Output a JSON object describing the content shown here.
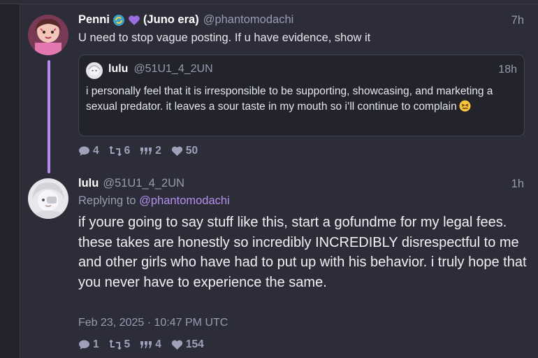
{
  "post": {
    "name": "Penni",
    "name_suffix": "(Juno era)",
    "handle": "@phantomodachi",
    "time": "7h",
    "text": "U need to stop vague posting. If u have evidence, show it",
    "quote": {
      "name": "lulu",
      "handle": "@51U1_4_2UN",
      "time": "18h",
      "text": "i personally feel that it is irresponsible to be supporting, showcasing, and marketing a sexual predator. it leaves a sour taste in my mouth so i’ll continue to complain"
    },
    "stats": {
      "replies": "4",
      "reposts": "6",
      "quotes": "2",
      "likes": "50"
    }
  },
  "reply": {
    "name": "lulu",
    "handle": "@51U1_4_2UN",
    "time": "1h",
    "replying_label": "Replying to",
    "replying_to": "@phantomodachi",
    "line1": "if youre going to say stuff like this, start a gofundme for my legal fees.",
    "line2": "these takes are honestly so incredibly INCREDIBLY disrespectful to me and other girls who have had to put up with his behavior. i truly hope that you never have to experience the same.",
    "date": "Feb 23, 2025 · 10:47 PM UTC",
    "stats": {
      "replies": "1",
      "reposts": "5",
      "quotes": "4",
      "likes": "154"
    }
  },
  "colors": {
    "accent": "#b08ee8",
    "mention": "#b48ef0",
    "stat": "#9fa1bb",
    "background": "#2c2d38"
  },
  "icons": [
    "comment-icon",
    "repost-icon",
    "quote-icon",
    "heart-icon",
    "recycle-heart-emoji",
    "purple-heart-emoji",
    "confounded-face-emoji"
  ]
}
